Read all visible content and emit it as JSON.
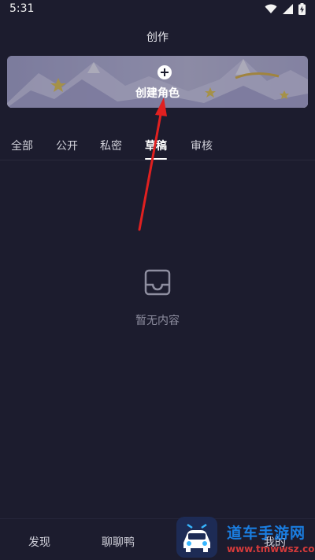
{
  "status_bar": {
    "time": "5:31",
    "icons": [
      "wifi-icon",
      "cellular-signal-icon",
      "battery-charging-icon"
    ]
  },
  "header": {
    "title": "创作"
  },
  "banner": {
    "label": "创建角色",
    "icon": "plus-icon"
  },
  "tabs": [
    {
      "label": "全部",
      "active": false
    },
    {
      "label": "公开",
      "active": false
    },
    {
      "label": "私密",
      "active": false
    },
    {
      "label": "草稿",
      "active": true
    },
    {
      "label": "审核",
      "active": false
    }
  ],
  "empty_state": {
    "icon": "inbox-tray-icon",
    "text": "暂无内容"
  },
  "bottom_nav": {
    "items": [
      {
        "label": "发现"
      },
      {
        "label": "聊聊鸭"
      },
      {
        "label": "我的"
      }
    ]
  },
  "watermark": {
    "title": "道车手游网",
    "url": "www.tmwwsz.com"
  },
  "colors": {
    "background": "#1c1c2e",
    "annotation_arrow": "#e02020",
    "watermark_blue": "#1a7de0",
    "watermark_red": "#d43a3a"
  }
}
